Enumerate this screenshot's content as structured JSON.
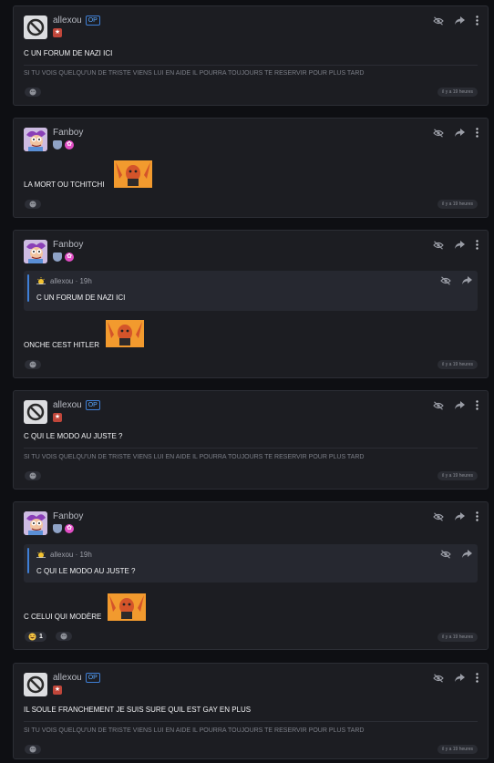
{
  "posts": [
    {
      "author": "allexou",
      "op_badge": "OP",
      "content": "C UN FORUM DE NAZI ICI",
      "signature": "SI TU VOIS QUELQU'UN DE TRISTE VIENS LUI EN AIDE IL POURRA TOUJOURS TE RESERVIR POUR PLUS TARD",
      "timestamp": "il y a 19 heures"
    },
    {
      "author": "Fanboy",
      "content": "LA MORT OU TCHITCHI",
      "timestamp": "il y a 19 heures"
    },
    {
      "author": "Fanboy",
      "quote": {
        "author": "allexou",
        "time": "19h",
        "text": "C UN FORUM DE NAZI ICI"
      },
      "content": "ONCHE CEST HITLER",
      "timestamp": "il y a 19 heures"
    },
    {
      "author": "allexou",
      "op_badge": "OP",
      "content": "C QUI LE MODO AU JUSTE ?",
      "signature": "SI TU VOIS QUELQU'UN DE TRISTE VIENS LUI EN AIDE IL POURRA TOUJOURS TE RESERVIR POUR PLUS TARD",
      "timestamp": "il y a 19 heures"
    },
    {
      "author": "Fanboy",
      "quote": {
        "author": "allexou",
        "time": "19h",
        "text": "C QUI LE MODO AU JUSTE ?"
      },
      "content": "C CELUI QUI MODÈRE",
      "reaction_count": "1",
      "timestamp": "il y a 19 heures"
    },
    {
      "author": "allexou",
      "op_badge": "OP",
      "content": "IL SOULE FRANCHEMENT JE SUIS SURE QUIL EST GAY EN PLUS",
      "signature": "SI TU VOIS QUELQU'UN DE TRISTE VIENS LUI EN AIDE IL POURRA TOUJOURS TE RESERVIR POUR PLUS TARD",
      "timestamp": "il y a 19 heures"
    }
  ],
  "quote_separator": " · ",
  "icons": [
    "ban-icon",
    "hide-eye-icon",
    "share-arrow-icon",
    "more-vertical-icon",
    "add-reaction-icon",
    "sun-icon",
    "laugh-emoji-icon"
  ],
  "colors": {
    "background": "#0e0f13",
    "card": "#1c1d22",
    "accent_blue": "#3f7fd6",
    "op_badge": "#5aa8ff"
  }
}
